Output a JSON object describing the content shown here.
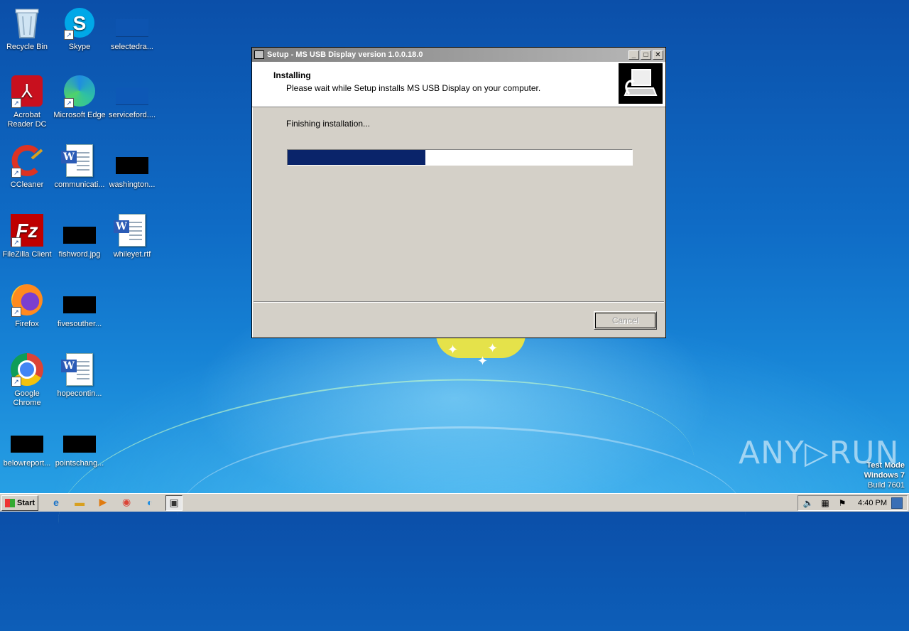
{
  "desktop": {
    "icons": [
      {
        "label": "Recycle Bin"
      },
      {
        "label": "Skype"
      },
      {
        "label": "selectedra..."
      },
      {
        "label": "Acrobat Reader DC"
      },
      {
        "label": "Microsoft Edge"
      },
      {
        "label": "serviceford...."
      },
      {
        "label": "CCleaner"
      },
      {
        "label": "communicati..."
      },
      {
        "label": "washington..."
      },
      {
        "label": "FileZilla Client"
      },
      {
        "label": "fishword.jpg"
      },
      {
        "label": "whileyet.rtf"
      },
      {
        "label": "Firefox"
      },
      {
        "label": "fivesouther..."
      },
      {
        "label": "Google Chrome"
      },
      {
        "label": "hopecontin..."
      },
      {
        "label": "belowreport..."
      },
      {
        "label": "pointschang..."
      }
    ]
  },
  "setup_window": {
    "title": "Setup - MS USB Display version 1.0.0.18.0",
    "header_title": "Installing",
    "header_subtitle": "Please wait while Setup installs MS USB Display on your computer.",
    "status": "Finishing installation...",
    "progress_percent": 40,
    "cancel_label": "Cancel"
  },
  "watermark": {
    "brand": "ANY▷RUN",
    "line1": "Test Mode",
    "line2": "Windows 7",
    "line3": "Build 7601"
  },
  "taskbar": {
    "start_label": "Start",
    "clock": "4:40 PM"
  },
  "colors": {
    "progress_fill": "#0a246a",
    "dialog_bg": "#d4d0c8"
  }
}
